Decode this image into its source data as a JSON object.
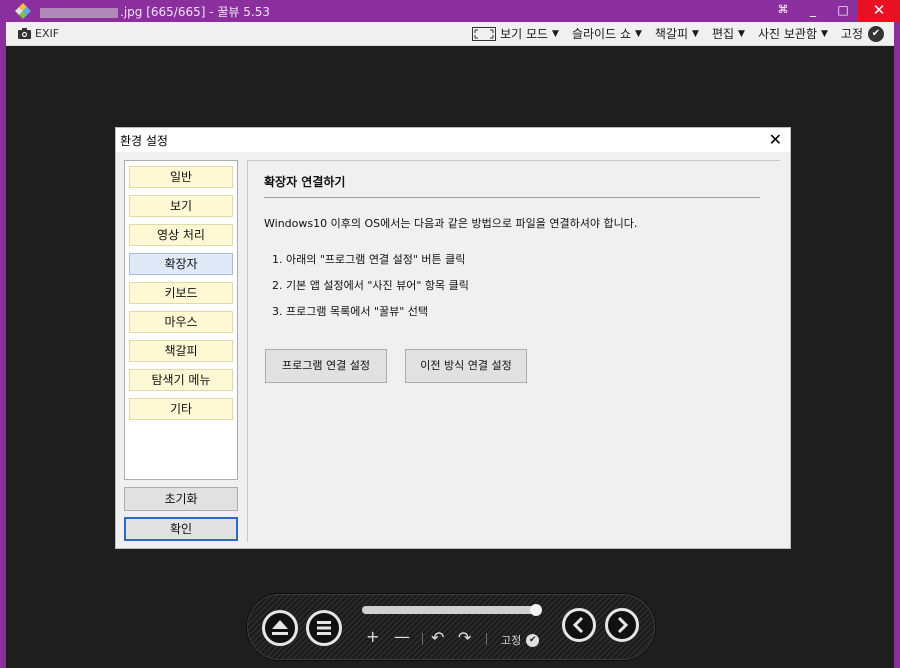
{
  "window": {
    "title_suffix": ".jpg [665/665] - 꿀뷰 5.53",
    "controls": {
      "pin": "⌘",
      "minimize": "_",
      "maximize": "□",
      "close": "✕"
    }
  },
  "toolbar": {
    "exif_label": "EXIF",
    "menus": [
      {
        "label": "보기 모드",
        "icon": "view-mode-icon"
      },
      {
        "label": "슬라이드 쇼"
      },
      {
        "label": "책갈피"
      },
      {
        "label": "편집"
      },
      {
        "label": "사진 보관함"
      }
    ],
    "pin_label": "고정"
  },
  "dialog": {
    "title": "환경 설정",
    "close": "✕",
    "nav": [
      {
        "label": "일반"
      },
      {
        "label": "보기"
      },
      {
        "label": "영상 처리"
      },
      {
        "label": "확장자",
        "active": true
      },
      {
        "label": "키보드"
      },
      {
        "label": "마우스"
      },
      {
        "label": "책갈피"
      },
      {
        "label": "탐색기 메뉴"
      },
      {
        "label": "기타"
      }
    ],
    "reset_button": "초기화",
    "ok_button": "확인",
    "content": {
      "title": "확장자 연결하기",
      "description": "Windows10 이후의 OS에서는 다음과 같은 방법으로 파일을 연결하셔야 합니다.",
      "steps": [
        "1. 아래의 \"프로그램 연결 설정\" 버튼 클릭",
        "2. 기본 앱 설정에서 \"사진 뷰어\" 항목  클릭",
        "3. 프로그램 목록에서 \"꿀뷰\" 선택"
      ],
      "buttons": [
        "프로그램 연결 설정",
        "이전 방식 연결 설정"
      ]
    }
  },
  "controller": {
    "progress": 0.98,
    "pin_label": "고정"
  },
  "colors": {
    "frame": "#8b2f9e",
    "close": "#e81123",
    "nav_bg": "#fff8d4",
    "nav_active": "#dfe9f7"
  }
}
